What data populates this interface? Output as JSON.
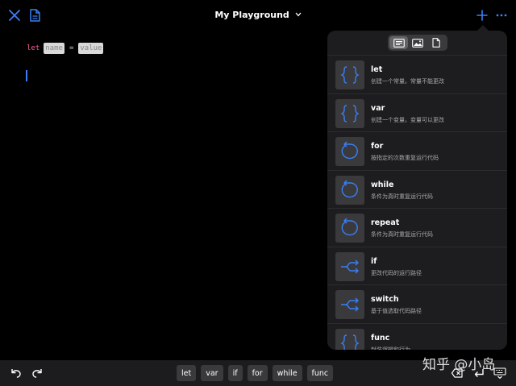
{
  "header": {
    "title": "My Playground"
  },
  "editor": {
    "keyword": "let",
    "placeholder_name": "name",
    "equals": "=",
    "placeholder_value": "value"
  },
  "popover": {
    "tabs": [
      "text-list-icon",
      "image-icon",
      "file-icon"
    ],
    "items": [
      {
        "title": "let",
        "desc": "创建一个常量。常量不能更改",
        "icon": "braces-icon"
      },
      {
        "title": "var",
        "desc": "创建一个变量。变量可以更改",
        "icon": "braces-icon"
      },
      {
        "title": "for",
        "desc": "按指定的次数重复运行代码",
        "icon": "loop-icon"
      },
      {
        "title": "while",
        "desc": "条件为真时重复运行代码",
        "icon": "loop-icon"
      },
      {
        "title": "repeat",
        "desc": "条件为真时重复运行代码",
        "icon": "loop-icon"
      },
      {
        "title": "if",
        "desc": "更改代码的运行路径",
        "icon": "branch-icon"
      },
      {
        "title": "switch",
        "desc": "基于值选取代码路径",
        "icon": "branch-icon"
      },
      {
        "title": "func",
        "desc": "封装逻辑和行为",
        "icon": "braces-icon"
      }
    ]
  },
  "keyboard_bar": {
    "chips": [
      "let",
      "var",
      "if",
      "for",
      "while",
      "func"
    ]
  },
  "watermark": "知乎 @小岛",
  "colors": {
    "accent": "#3a7ff6",
    "keyword": "#fc5fa3",
    "background": "#000000",
    "popover": "#1d1d1f"
  }
}
